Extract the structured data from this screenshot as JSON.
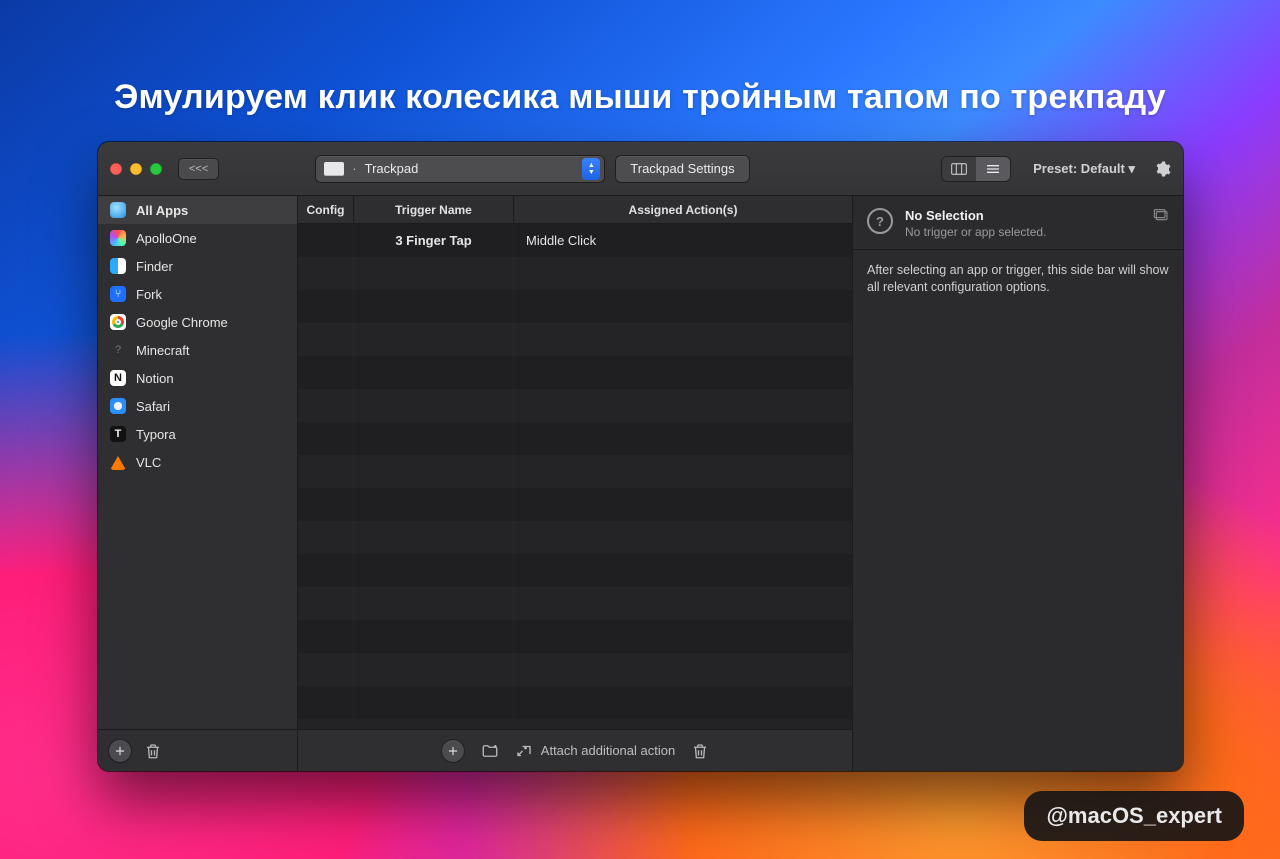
{
  "overlay_title": "Эмулируем клик колесика мыши тройным тапом по трекпаду",
  "watermark": "@macOS_expert",
  "toolbar": {
    "back_label": "<<<",
    "device_dropdown": {
      "label": "Trackpad"
    },
    "settings_button": "Trackpad Settings",
    "preset_label": "Preset: Default ▾"
  },
  "sidebar": {
    "items": [
      {
        "label": "All Apps",
        "icon": "globe",
        "selected": true
      },
      {
        "label": "ApolloOne",
        "icon": "apollo"
      },
      {
        "label": "Finder",
        "icon": "finder"
      },
      {
        "label": "Fork",
        "icon": "fork"
      },
      {
        "label": "Google Chrome",
        "icon": "chrome"
      },
      {
        "label": "Minecraft",
        "icon": "mc"
      },
      {
        "label": "Notion",
        "icon": "notion"
      },
      {
        "label": "Safari",
        "icon": "safari"
      },
      {
        "label": "Typora",
        "icon": "typora"
      },
      {
        "label": "VLC",
        "icon": "vlc"
      }
    ]
  },
  "table": {
    "headers": {
      "config": "Config",
      "trigger": "Trigger Name",
      "action": "Assigned Action(s)"
    },
    "rows": [
      {
        "config": "",
        "trigger": "3 Finger Tap",
        "action": "Middle Click"
      }
    ],
    "blank_rows": 14
  },
  "center_footer": {
    "attach_label": "Attach additional action"
  },
  "right_panel": {
    "title": "No Selection",
    "subtitle": "No trigger or app selected.",
    "body": "After selecting an app or trigger, this side bar will show all relevant configuration options."
  }
}
